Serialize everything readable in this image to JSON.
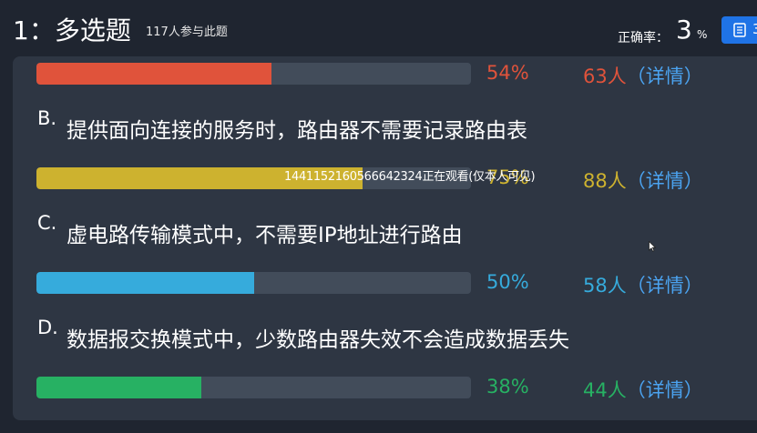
{
  "header": {
    "title": "1：多选题",
    "participants": "117人参与此题",
    "accuracy_label": "正确率：",
    "accuracy_value": "3",
    "accuracy_unit": "%",
    "list_button_partial": "3",
    "list_button_icon": "list-icon"
  },
  "colors": {
    "background": "#1f2530",
    "panel": "#2e3643",
    "track": "#424c5a",
    "detail_link": "#4ba3f0",
    "list_button": "#1f73e6"
  },
  "options": [
    {
      "letter": "",
      "text": "",
      "percent": "54%",
      "fraction": 0.54,
      "count": "63人",
      "open_paren": "（",
      "detail": "详情",
      "close_paren": "）",
      "color": "#e0533b"
    },
    {
      "letter": "B.",
      "text": "提供面向连接的服务时，路由器不需要记录路由表",
      "percent": "75%",
      "fraction": 0.75,
      "count": "88人",
      "open_paren": "（",
      "detail": "详情",
      "close_paren": "）",
      "color": "#cdb22f"
    },
    {
      "letter": "C.",
      "text": "虚电路传输模式中，不需要IP地址进行路由",
      "percent": "50%",
      "fraction": 0.5,
      "count": "58人",
      "open_paren": "（",
      "detail": "详情",
      "close_paren": "）",
      "color": "#36abdc"
    },
    {
      "letter": "D.",
      "text": "数据报交换模式中，少数路由器失效不会造成数据丢失",
      "percent": "38%",
      "fraction": 0.38,
      "count": "44人",
      "open_paren": "（",
      "detail": "详情",
      "close_paren": "）",
      "color": "#27b163"
    }
  ],
  "watermark": "1441152160566642324正在观看(仅本人可见)"
}
